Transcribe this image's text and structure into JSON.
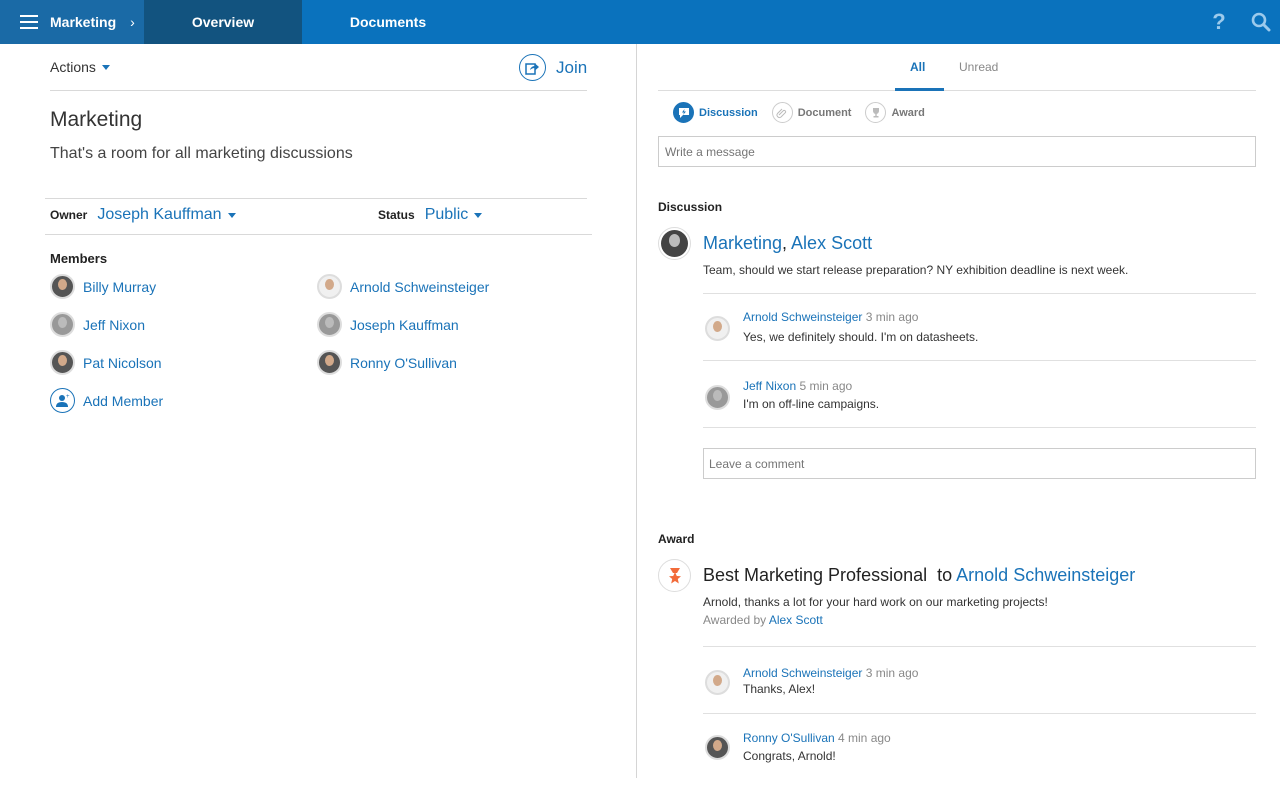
{
  "topbar": {
    "app_title": "Marketing",
    "tabs": [
      {
        "label": "Overview",
        "active": true
      },
      {
        "label": "Documents",
        "active": false
      }
    ],
    "help_icon": "?",
    "colors": {
      "bar": "#0a72bd",
      "home": "#1a6aa6",
      "active_tab": "#12537f"
    }
  },
  "left": {
    "actions_label": "Actions",
    "join_label": "Join",
    "room_title": "Marketing",
    "room_description": "That's a room for all marketing discussions",
    "owner_label": "Owner",
    "owner_value": "Joseph Kauffman",
    "status_label": "Status",
    "status_value": "Public",
    "members_label": "Members",
    "members": [
      {
        "name": "Billy Murray"
      },
      {
        "name": "Arnold Schweinsteiger"
      },
      {
        "name": "Jeff Nixon"
      },
      {
        "name": "Joseph Kauffman"
      },
      {
        "name": "Pat Nicolson"
      },
      {
        "name": "Ronny O'Sullivan"
      }
    ],
    "add_member_label": "Add Member"
  },
  "right": {
    "tabs": [
      {
        "label": "All",
        "active": true
      },
      {
        "label": "Unread",
        "active": false
      }
    ],
    "post_types": [
      {
        "label": "Discussion",
        "icon": "discussion-icon",
        "active": true
      },
      {
        "label": "Document",
        "icon": "paperclip-icon",
        "active": false
      },
      {
        "label": "Award",
        "icon": "trophy-icon",
        "active": false
      }
    ],
    "message_placeholder": "Write a message",
    "discussion": {
      "section_label": "Discussion",
      "title_part1": "Marketing",
      "title_sep": ", ",
      "title_part2": "Alex Scott",
      "body": "Team, should we start release preparation? NY exhibition deadline is next week.",
      "comments": [
        {
          "author": "Arnold Schweinsteiger",
          "time": "3 min ago",
          "text": "Yes, we definitely should.  I'm on datasheets."
        },
        {
          "author": "Jeff Nixon",
          "time": "5 min ago",
          "text": "I'm on off-line campaigns."
        }
      ],
      "comment_placeholder": "Leave a comment"
    },
    "award": {
      "section_label": "Award",
      "award_name": "Best Marketing Professional",
      "to_label": "to",
      "recipient": "Arnold Schweinsteiger",
      "body": "Arnold, thanks a lot for your hard work on our marketing projects!",
      "awarded_by_label": "Awarded by",
      "awarded_by": "Alex Scott",
      "comments": [
        {
          "author": "Arnold Schweinsteiger",
          "time": "3 min ago",
          "text": "Thanks, Alex!"
        },
        {
          "author": "Ronny O'Sullivan",
          "time": "4 min ago",
          "text": "Congrats, Arnold!"
        }
      ],
      "icon_color": "#f26b3a"
    }
  }
}
